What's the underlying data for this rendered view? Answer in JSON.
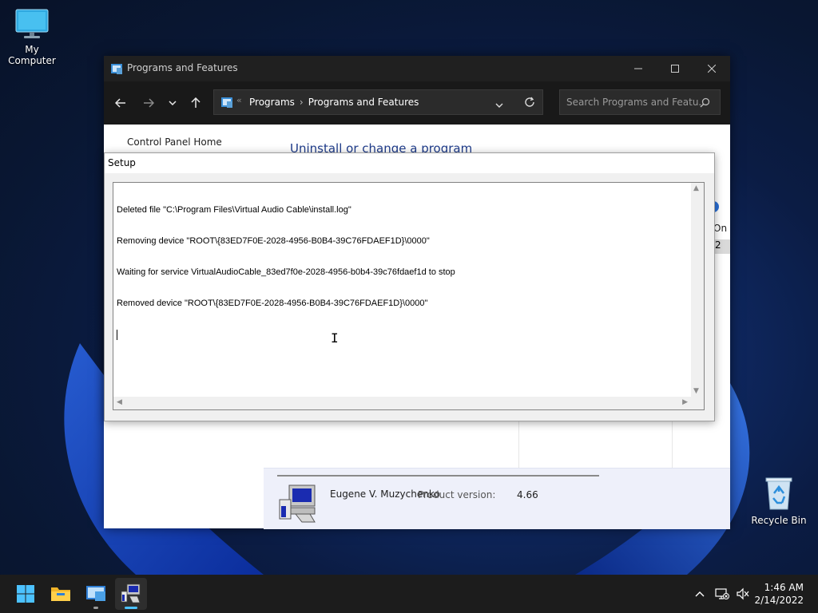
{
  "desktop": {
    "icons": [
      {
        "label": "My Computer",
        "icon": "monitor-icon"
      },
      {
        "label": "Recycle Bin",
        "icon": "recycle-bin-icon"
      }
    ]
  },
  "explorer": {
    "title": "Programs and Features",
    "breadcrumb": {
      "root_glyph": "«",
      "items": [
        "Programs",
        "Programs and Features"
      ],
      "separator": "›"
    },
    "search_placeholder": "Search Programs and Featu...",
    "sidebar": {
      "control_panel_home": "Control Panel Home"
    },
    "main": {
      "heading": "Uninstall or change a program",
      "column_fragment": "On",
      "cell_fragment": "2"
    },
    "details": {
      "publisher": "Eugene V. Muzychenko",
      "product_version_label": "Product version:",
      "product_version": "4.66"
    }
  },
  "setup": {
    "title": "Setup",
    "log_lines": [
      "Deleted file \"C:\\Program Files\\Virtual Audio Cable\\install.log\"",
      "Removing device \"ROOT\\{83ED7F0E-2028-4956-B0B4-39C76FDAEF1D}\\0000\"",
      "Waiting for service VirtualAudioCable_83ed7f0e-2028-4956-b0b4-39c76fdaef1d to stop",
      "Removed device \"ROOT\\{83ED7F0E-2028-4956-B0B4-39C76FDAEF1D}\\0000\""
    ]
  },
  "taskbar": {
    "items": [
      "start-icon",
      "file-explorer-icon",
      "control-panel-icon",
      "setup-app-icon"
    ],
    "active_index": 3,
    "clock": {
      "time": "1:46 AM",
      "date": "2/14/2022"
    }
  },
  "colors": {
    "accent": "#4cc2ff",
    "titlebar": "#202020",
    "link_blue": "#1e3b8a"
  }
}
